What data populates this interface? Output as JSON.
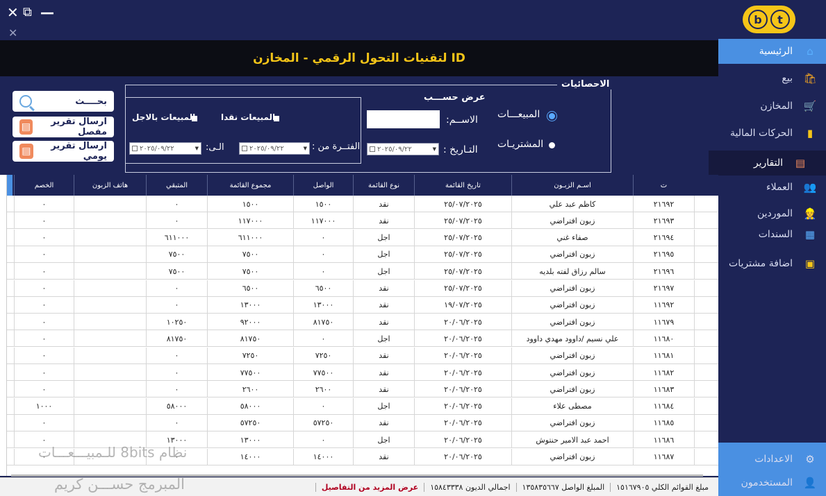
{
  "window": {
    "close_glyph": "✕",
    "restore_glyph": "⧉",
    "minimize_glyph": "—",
    "close2_glyph": "✕"
  },
  "title": "ID لتقنيات التحول الرقمي  - المخازن",
  "logo": {
    "left": "b",
    "right": "t"
  },
  "sidebar": {
    "items": [
      {
        "label": "الرئيسية",
        "icon": "home-icon",
        "glyph": "⌂",
        "color": "#5ab0ff"
      },
      {
        "label": "بيع",
        "icon": "shopping-bag-icon",
        "glyph": "🛍",
        "color": "#f5a623"
      },
      {
        "label": "المخازن",
        "icon": "cart-icon",
        "glyph": "🛒",
        "color": "#f5c518"
      },
      {
        "label": "الحركات المالية",
        "icon": "bar-chart-icon",
        "glyph": "▮",
        "color": "#f5c518"
      },
      {
        "label": "التقارير",
        "icon": "report-icon",
        "glyph": "▤",
        "color": "#f08a5d"
      },
      {
        "label": "العملاء",
        "icon": "customers-icon",
        "glyph": "👥",
        "color": "#f5a623"
      },
      {
        "label": "الموردين",
        "icon": "suppliers-icon",
        "glyph": "👷",
        "color": "#f5c518"
      },
      {
        "label": "السندات",
        "icon": "documents-icon",
        "glyph": "▦",
        "color": "#5ab0ff"
      },
      {
        "label": "اضافة مشتريات",
        "icon": "box-icon",
        "glyph": "▣",
        "color": "#f5c518"
      }
    ],
    "settings": {
      "label": "الاعدادات",
      "icon": "settings-icon",
      "glyph": "⚙"
    },
    "users": {
      "label": "المستخدمون",
      "icon": "user-icon",
      "glyph": "👤"
    }
  },
  "stats": {
    "legend": "الاحصائيات",
    "view_by_legend": "عرض حســـب",
    "sales_label": "المبيعـــات",
    "purchases_label": "المشتريـات",
    "name_label": "الاســم:",
    "date_label": "التـاريخ :",
    "period_from_label": "الفتــرة من :",
    "to_label": "الـى:",
    "date_value": "٢٠٢٥/٠٩/٢٢",
    "cash_sales_label": "المبيعات نقدا",
    "credit_sales_label": "المبيعات بالاجل"
  },
  "buttons": {
    "search": "بحــــث",
    "detailed_report": "ارسال تقرير مفصل",
    "daily_report": "ارسال تقرير يومي"
  },
  "table": {
    "columns": [
      "ت",
      "اسـم الزبـون",
      "تاريخ القائمة",
      "نوع القائمة",
      "الواصل",
      "مجموع القائمة",
      "المتبقي",
      "هاتف الزبون",
      "الخصم"
    ],
    "rows": [
      [
        "٢١٦٩٢",
        "كاظم  عبد علي",
        "٢٥/٠٧/٢٠٢٥",
        "نقد",
        "١٥٠٠",
        "١٥٠٠",
        "٠",
        "",
        "٠"
      ],
      [
        "٢١٦٩٣",
        "زبون افتراضي",
        "٢٥/٠٧/٢٠٢٥",
        "نقد",
        "١١٧٠٠٠",
        "١١٧٠٠٠",
        "٠",
        "",
        "٠"
      ],
      [
        "٢١٦٩٤",
        "صفاء غني",
        "٢٥/٠٧/٢٠٢٥",
        "اجل",
        "٠",
        "٦١١٠٠٠",
        "٦١١٠٠٠",
        "",
        "٠"
      ],
      [
        "٢١٦٩٥",
        "زبون افتراضي",
        "٢٥/٠٧/٢٠٢٥",
        "اجل",
        "٠",
        "٧٥٠٠",
        "٧٥٠٠",
        "",
        "٠"
      ],
      [
        "٢١٦٩٦",
        "سالم رزاق لفته بلديه",
        "٢٥/٠٧/٢٠٢٥",
        "اجل",
        "٠",
        "٧٥٠٠",
        "٧٥٠٠",
        "",
        "٠"
      ],
      [
        "٢١٦٩٧",
        "زبون افتراضي",
        "٢٥/٠٧/٢٠٢٥",
        "نقد",
        "٦٥٠٠",
        "٦٥٠٠",
        "٠",
        "",
        "٠"
      ],
      [
        "١١٦٩٢",
        "زبون افتراضي",
        "١٩/٠٧/٢٠٢٥",
        "نقد",
        "١٣٠٠٠",
        "١٣٠٠٠",
        "٠",
        "",
        "٠"
      ],
      [
        "١١٦٧٩",
        "زبون افتراضي",
        "٢٠/٠٦/٢٠٢٥",
        "نقد",
        "٨١٧٥٠",
        "٩٢٠٠٠",
        "١٠٢٥٠",
        "",
        "٠"
      ],
      [
        "١١٦٨٠",
        "علي نسيم /داوود مهدي داوود",
        "٢٠/٠٦/٢٠٢٥",
        "اجل",
        "٠",
        "٨١٧٥٠",
        "٨١٧٥٠",
        "",
        "٠"
      ],
      [
        "١١٦٨١",
        "زبون افتراضي",
        "٢٠/٠٦/٢٠٢٥",
        "نقد",
        "٧٢٥٠",
        "٧٢٥٠",
        "٠",
        "",
        "٠"
      ],
      [
        "١١٦٨٢",
        "زبون افتراضي",
        "٢٠/٠٦/٢٠٢٥",
        "نقد",
        "٧٧٥٠٠",
        "٧٧٥٠٠",
        "٠",
        "",
        "٠"
      ],
      [
        "١١٦٨٣",
        "زبون افتراضي",
        "٢٠/٠٦/٢٠٢٥",
        "نقد",
        "٢٦٠٠",
        "٢٦٠٠",
        "٠",
        "",
        "٠"
      ],
      [
        "١١٦٨٤",
        "مصطى علاء",
        "٢٠/٠٦/٢٠٢٥",
        "اجل",
        "٠",
        "٥٨٠٠٠",
        "٥٨٠٠٠",
        "",
        "١٠٠٠"
      ],
      [
        "١١٦٨٥",
        "زبون افتراضي",
        "٢٠/٠٦/٢٠٢٥",
        "نقد",
        "٥٧٢٥٠",
        "٥٧٢٥٠",
        "٠",
        "",
        "٠"
      ],
      [
        "١١٦٨٦",
        "احمد عبد الامير حنتوش",
        "٢٠/٠٦/٢٠٢٥",
        "اجل",
        "٠",
        "١٣٠٠٠",
        "١٣٠٠٠",
        "",
        "٠"
      ],
      [
        "١١٦٨٧",
        "زبون افتراضي",
        "٢٠/٠٦/٢٠٢٥",
        "نقد",
        "١٤٠٠٠",
        "١٤٠٠٠",
        "٠",
        "",
        "٠"
      ]
    ]
  },
  "status": {
    "total_invoices": "مبلغ القوائم الكلي  ١٥١٦٧٩٠٥",
    "received": "المبلغ الواصل  ١٣٥٨٣٥٦٦٧",
    "debts": "اجمالي الديون  ١٥٨٤٣٣٣٨",
    "more_details": "عرض المزيد من التفاصيل"
  },
  "watermark": {
    "line1": "نظام 8bits للـمبيـــعـــات",
    "line2": "المبرمج حســـن كريم"
  }
}
